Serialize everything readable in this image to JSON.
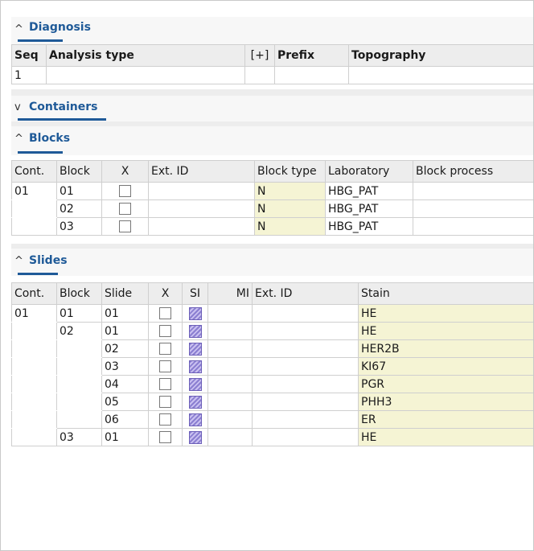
{
  "diagnosis": {
    "title": "Diagnosis",
    "headers": [
      "Seq",
      "Analysis type",
      "[+]",
      "Prefix",
      "Topography"
    ],
    "rows": [
      [
        "1",
        "",
        "",
        "",
        ""
      ]
    ]
  },
  "containers": {
    "title": "Containers"
  },
  "blocks": {
    "title": "Blocks",
    "headers": [
      "Cont.",
      "Block",
      "X",
      "Ext. ID",
      "Block type",
      "Laboratory",
      "Block process"
    ],
    "rows": [
      {
        "cont": "01",
        "block": "01",
        "ext": "",
        "type": "N",
        "lab": "HBG_PAT",
        "process": ""
      },
      {
        "cont": "",
        "block": "02",
        "ext": "",
        "type": "N",
        "lab": "HBG_PAT",
        "process": ""
      },
      {
        "cont": "",
        "block": "03",
        "ext": "",
        "type": "N",
        "lab": "HBG_PAT",
        "process": ""
      }
    ]
  },
  "slides": {
    "title": "Slides",
    "headers": [
      "Cont.",
      "Block",
      "Slide",
      "X",
      "SI",
      "MI",
      "Ext. ID",
      "Stain"
    ],
    "rows": [
      {
        "cont": "01",
        "block": "01",
        "slide": "01",
        "stain": "HE"
      },
      {
        "cont": "",
        "block": "02",
        "slide": "01",
        "stain": "HE"
      },
      {
        "cont": "",
        "block": "",
        "slide": "02",
        "stain": "HER2B"
      },
      {
        "cont": "",
        "block": "",
        "slide": "03",
        "stain": "KI67"
      },
      {
        "cont": "",
        "block": "",
        "slide": "04",
        "stain": "PGR"
      },
      {
        "cont": "",
        "block": "",
        "slide": "05",
        "stain": "PHH3"
      },
      {
        "cont": "",
        "block": "",
        "slide": "06",
        "stain": "ER"
      },
      {
        "cont": "",
        "block": "03",
        "slide": "01",
        "stain": "HE"
      }
    ]
  }
}
